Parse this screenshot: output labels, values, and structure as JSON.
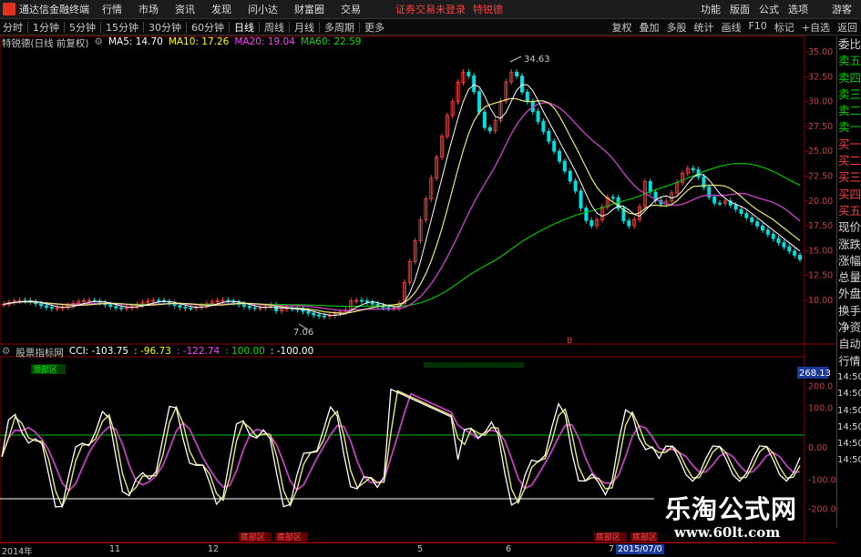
{
  "window": {
    "title": "通达信金融终端",
    "menus": [
      "行情",
      "市场",
      "资讯",
      "发现",
      "问小达",
      "财富圈",
      "交易"
    ],
    "warning": "证券交易未登录",
    "stock_tag": "特锐德",
    "right_menus": [
      "功能",
      "版面",
      "公式",
      "选项"
    ],
    "guest": "游客"
  },
  "toolbar": {
    "periods": [
      "分时",
      "1分钟",
      "5分钟",
      "15分钟",
      "30分钟",
      "60分钟",
      "日线",
      "周线",
      "月线",
      "多周期",
      "更多"
    ],
    "active_period": "日线",
    "tools": [
      "复权",
      "叠加",
      "多股",
      "统计",
      "画线",
      "F10",
      "标记",
      "+自选",
      "返回"
    ]
  },
  "main_chart": {
    "stock": "特锐德(日线 前复权)",
    "ma_labels": [
      {
        "text": "MA5: 14.70",
        "color": "#ffffff"
      },
      {
        "text": "MA10: 17.26",
        "color": "#ffff00"
      },
      {
        "text": "MA20: 19.04",
        "color": "#ff40ff"
      },
      {
        "text": "MA60: 22.59",
        "color": "#00e000"
      }
    ],
    "max_label": "34.63",
    "min_label": "7.06",
    "y_ticks": [
      "35.00",
      "32.50",
      "30.00",
      "27.50",
      "25.00",
      "22.50",
      "20.00",
      "17.50",
      "15.00",
      "12.50",
      "10.00"
    ],
    "marker_b": "B"
  },
  "indicator": {
    "name": "股票指标网",
    "values": [
      {
        "text": "CCI: -103.75",
        "color": "#ffffff"
      },
      {
        "text": ": -96.73",
        "color": "#ffff00"
      },
      {
        "text": ": -122.74",
        "color": "#ff40ff"
      },
      {
        "text": ": 100.00",
        "color": "#00e000"
      },
      {
        "text": ": -100.00",
        "color": "#ffffff"
      }
    ],
    "current": "268.13",
    "y_ticks": [
      "200.0",
      "100.0",
      "0.00",
      "-100.0",
      "-200.0"
    ],
    "green_tag": "顶部区",
    "red_tags": [
      "底部区",
      "底部区",
      "底部区",
      "底部区"
    ]
  },
  "axis": {
    "labels": [
      "2014年",
      "11",
      "12",
      "5",
      "6",
      "7",
      "2015/07/0"
    ]
  },
  "side_panel": {
    "items": [
      "委比",
      "卖五",
      "卖四",
      "卖三",
      "卖二",
      "卖一",
      "买一",
      "买二",
      "买三",
      "买四",
      "买五",
      "现价",
      "涨跌",
      "涨幅",
      "总量",
      "外盘",
      "换手",
      "净资"
    ],
    "footer": [
      "自动",
      "行情",
      "14:50",
      "14:50",
      "14:50",
      "14:50",
      "14:50",
      "14:50"
    ]
  },
  "watermark": {
    "title": "乐淘公式网",
    "url": "www.60lt.com"
  }
}
